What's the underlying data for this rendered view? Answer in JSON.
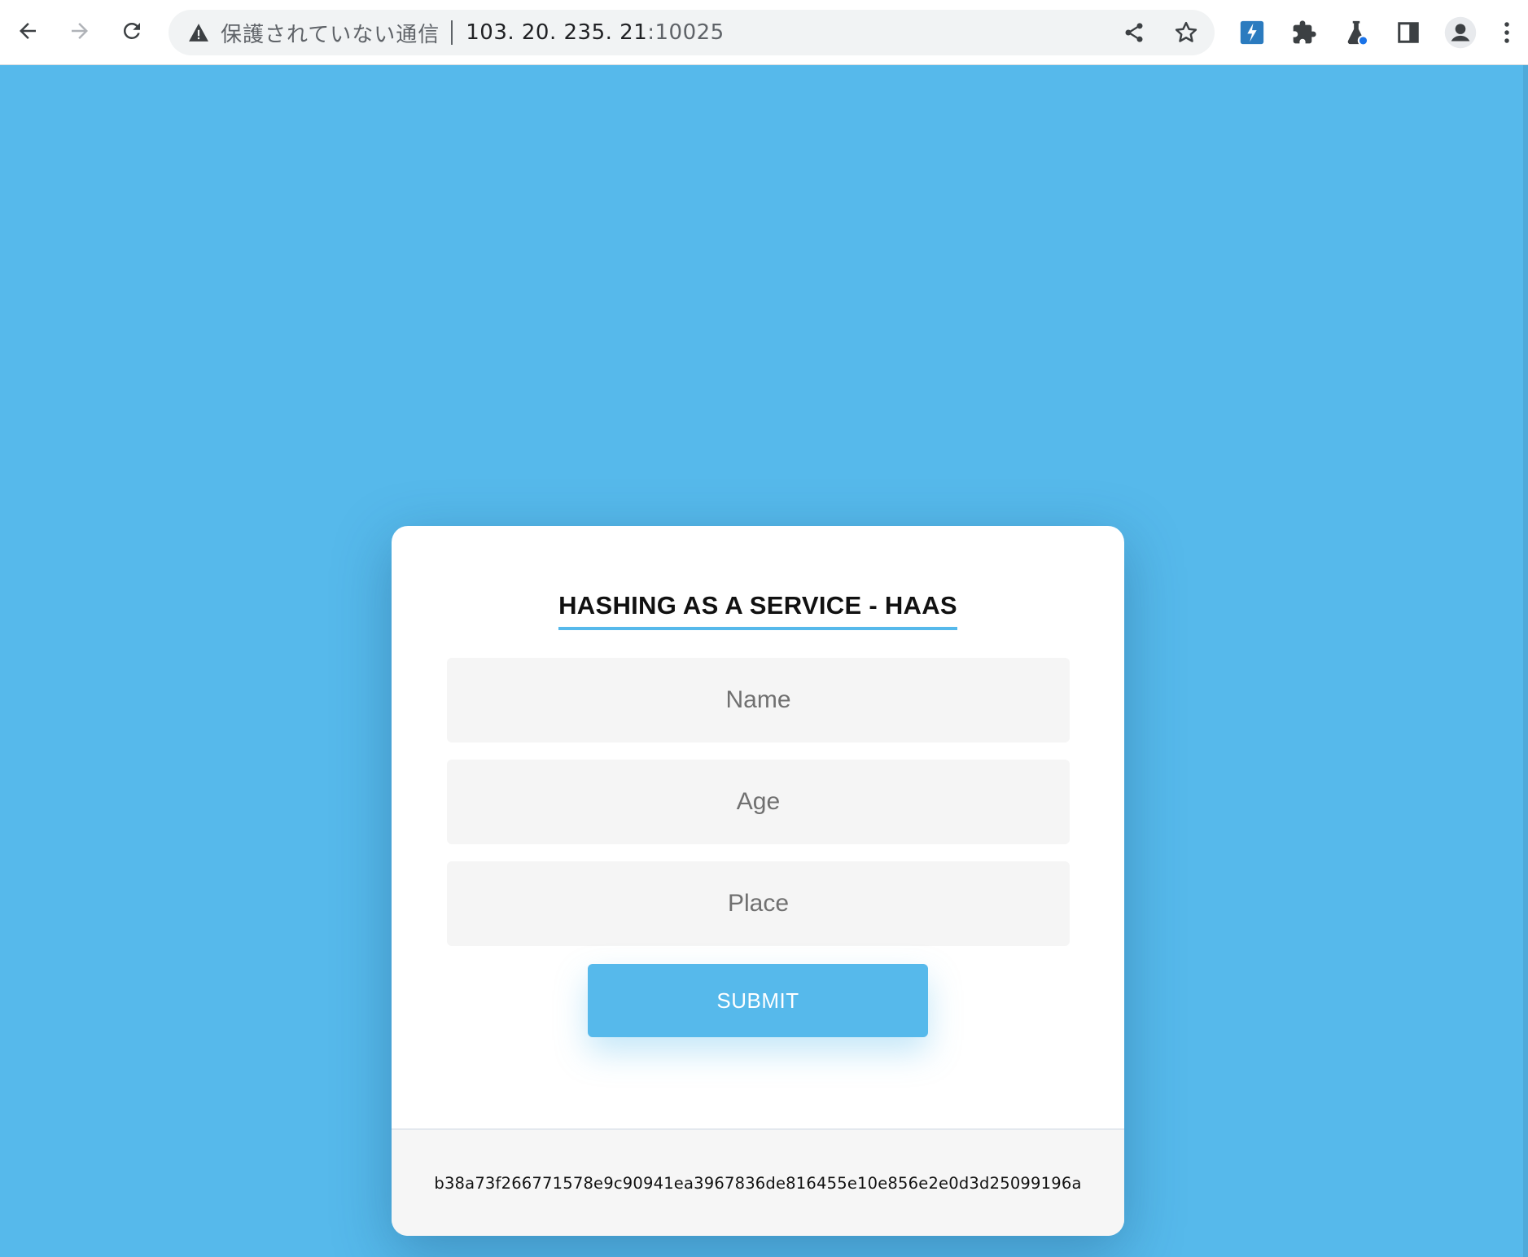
{
  "browser": {
    "security_text": "保護されていない通信",
    "url_host": "103. 20. 235. 21",
    "url_port": ":10025",
    "icons": [
      "back-icon",
      "forward-icon",
      "reload-icon",
      "warning-icon",
      "share-icon",
      "star-icon",
      "extension-shortcut-icon",
      "puzzle-icon",
      "labs-flask-icon",
      "side-panel-icon",
      "profile-icon",
      "more-menu-icon"
    ]
  },
  "page": {
    "title": "HASHING AS A SERVICE - HAAS",
    "fields": {
      "name_placeholder": "Name",
      "age_placeholder": "Age",
      "place_placeholder": "Place"
    },
    "submit_label": "SUBMIT",
    "hash_output": "b38a73f266771578e9c90941ea3967836de816455e10e856e2e0d3d25099196a"
  },
  "colors": {
    "background": "#56b9eb",
    "accent": "#56b9eb",
    "card": "#ffffff"
  }
}
